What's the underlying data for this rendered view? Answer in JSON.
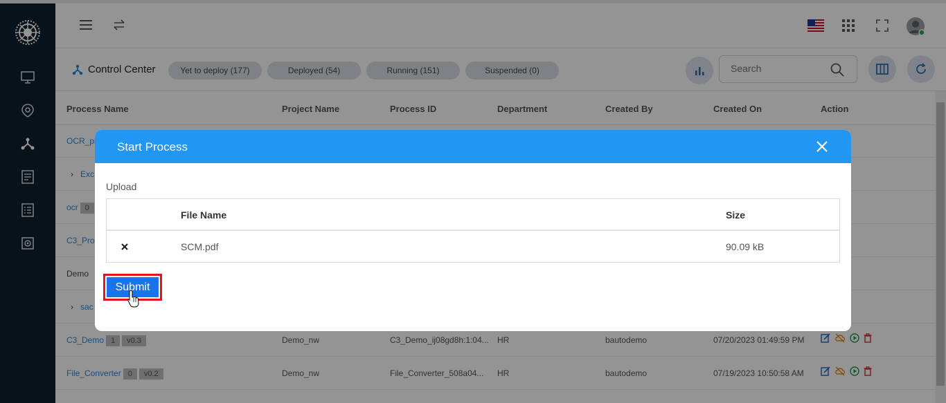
{
  "header": {
    "language_flag": "us-flag-icon",
    "apps_icon": "grid-icon",
    "fullscreen_icon": "expand-icon",
    "avatar_status_color": "#2ea44f"
  },
  "subheader": {
    "title": "Control Center",
    "pills": [
      {
        "label": "Yet to deploy (177)"
      },
      {
        "label": "Deployed (54)"
      },
      {
        "label": "Running (151)"
      },
      {
        "label": "Suspended (0)"
      }
    ],
    "search_placeholder": "Search"
  },
  "table": {
    "columns": [
      "Process Name",
      "Project Name",
      "Process ID",
      "Department",
      "Created By",
      "Created On",
      "Action"
    ],
    "rows": [
      {
        "name": "OCR_pr",
        "project": "",
        "pid": "",
        "dept": "",
        "by": "",
        "on": ""
      },
      {
        "name": "Exc",
        "project": "",
        "pid": "",
        "dept": "",
        "by": "",
        "on": ""
      },
      {
        "name": "ocr",
        "badge1": "0",
        "project": "",
        "pid": "",
        "dept": "",
        "by": "",
        "on": ""
      },
      {
        "name": "C3_Pro",
        "project": "",
        "pid": "",
        "dept": "",
        "by": "",
        "on": ""
      },
      {
        "name": "Demo",
        "project": "",
        "pid": "",
        "dept": "",
        "by": "",
        "on": ""
      },
      {
        "name": "sac",
        "project": "",
        "pid": "",
        "dept": "",
        "by": "",
        "on": ""
      },
      {
        "name": "C3_Demo",
        "badge1": "1",
        "badge2": "v0.3",
        "project": "Demo_nw",
        "pid": "C3_Demo_ij08gd8h:1:04...",
        "dept": "HR",
        "by": "bautodemo",
        "on": "07/20/2023 01:49:59 PM"
      },
      {
        "name": "File_Converter",
        "badge1": "0",
        "badge2": "v0.2",
        "project": "Demo_nw",
        "pid": "File_Converter_508a04...",
        "dept": "HR",
        "by": "bautodemo",
        "on": "07/19/2023 10:50:58 AM"
      }
    ]
  },
  "modal": {
    "title": "Start Process",
    "upload_label": "Upload",
    "file_columns": [
      "File Name",
      "Size"
    ],
    "file": {
      "name": "SCM.pdf",
      "size": "90.09 kB"
    },
    "submit_label": "Submit"
  },
  "colors": {
    "accent": "#2196f3",
    "sidebar_bg": "#0f1f2d",
    "submit_bg": "#1a73e8",
    "highlight": "#e3151a"
  }
}
